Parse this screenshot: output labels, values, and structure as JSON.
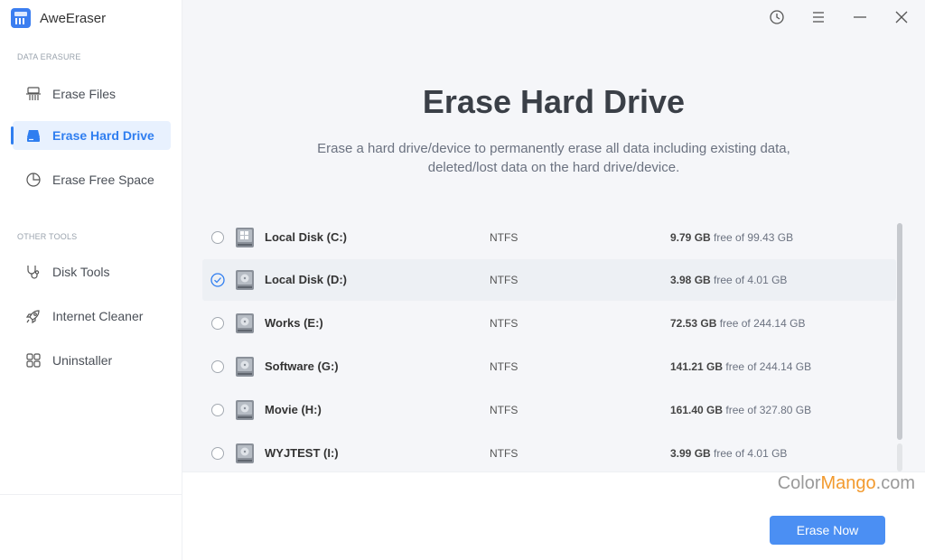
{
  "app": {
    "name": "AweEraser"
  },
  "sidebar": {
    "sections": [
      {
        "label": "DATA ERASURE"
      },
      {
        "label": "OTHER TOOLS"
      }
    ],
    "items": [
      {
        "label": "Erase Files",
        "icon": "shredder-icon"
      },
      {
        "label": "Erase Hard Drive",
        "icon": "hard-drive-icon",
        "active": true
      },
      {
        "label": "Erase Free Space",
        "icon": "pie-chart-icon"
      },
      {
        "label": "Disk Tools",
        "icon": "stethoscope-icon"
      },
      {
        "label": "Internet Cleaner",
        "icon": "rocket-icon"
      },
      {
        "label": "Uninstaller",
        "icon": "apps-grid-icon"
      }
    ]
  },
  "window_controls": [
    "history-icon",
    "menu-icon",
    "minimize-icon",
    "close-icon"
  ],
  "main": {
    "title": "Erase Hard Drive",
    "subtitle": "Erase a hard drive/device to permanently erase all data including existing data, deleted/lost data on the hard drive/device."
  },
  "disks": [
    {
      "name": "Local Disk (C:)",
      "fs": "NTFS",
      "free": "9.79 GB",
      "total_text": "free of 99.43 GB",
      "selected": false,
      "system": true
    },
    {
      "name": "Local Disk (D:)",
      "fs": "NTFS",
      "free": "3.98 GB",
      "total_text": "free of 4.01 GB",
      "selected": true,
      "system": false
    },
    {
      "name": "Works (E:)",
      "fs": "NTFS",
      "free": "72.53 GB",
      "total_text": "free of 244.14 GB",
      "selected": false,
      "system": false
    },
    {
      "name": "Software (G:)",
      "fs": "NTFS",
      "free": "141.21 GB",
      "total_text": "free of 244.14 GB",
      "selected": false,
      "system": false
    },
    {
      "name": "Movie (H:)",
      "fs": "NTFS",
      "free": "161.40 GB",
      "total_text": "free of 327.80 GB",
      "selected": false,
      "system": false
    },
    {
      "name": "WYJTEST (I:)",
      "fs": "NTFS",
      "free": "3.99 GB",
      "total_text": "free of 4.01 GB",
      "selected": false,
      "system": false
    }
  ],
  "actions": {
    "erase_now": "Erase Now"
  },
  "watermark": {
    "part1": "Color",
    "part2": "Mango",
    "part3": ".com"
  },
  "colors": {
    "accent": "#2f7ef0",
    "button": "#4b8ff3",
    "active_bg": "#e8f1fe"
  }
}
